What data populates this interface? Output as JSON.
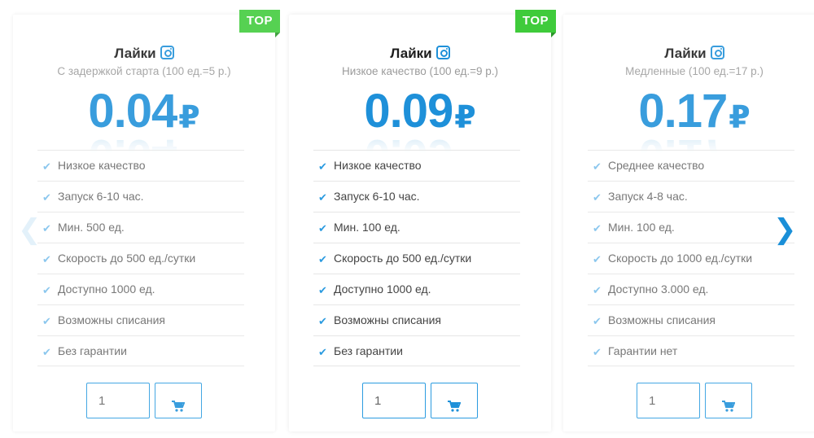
{
  "nav": {
    "prev_glyph": "❮",
    "next_glyph": "❯"
  },
  "cards": [
    {
      "badge": "TOP",
      "title": "Лайки",
      "subtitle": "С задержкой старта (100 ед.=5 р.)",
      "price": "0.04",
      "currency": "₽",
      "features": [
        "Низкое качество",
        "Запуск 6-10 час.",
        "Мин. 500 ед.",
        "Скорость до 500 ед./сутки",
        "Доступно 1000 ед.",
        "Возможны списания",
        "Без гарантии"
      ],
      "quantity": "1"
    },
    {
      "badge": "TOP",
      "title": "Лайки",
      "subtitle": "Низкое качество (100 ед.=9 р.)",
      "price": "0.09",
      "currency": "₽",
      "features": [
        "Низкое качество",
        "Запуск 6-10 час.",
        "Мин. 100 ед.",
        "Скорость до 500 ед./сутки",
        "Доступно 1000 ед.",
        "Возможны списания",
        "Без гарантии"
      ],
      "quantity": "1"
    },
    {
      "badge": "",
      "title": "Лайки",
      "subtitle": "Медленные (100 ед.=17 р.)",
      "price": "0.17",
      "currency": "₽",
      "features": [
        "Среднее качество",
        "Запуск 4-8 час.",
        "Мин. 100 ед.",
        "Скорость до 1000 ед./сутки",
        "Доступно 3.000 ед.",
        "Возможны списания",
        "Гарантии нет"
      ],
      "quantity": "1"
    }
  ],
  "icons": {
    "title": "instagram-icon",
    "feature": "check-icon",
    "button": "cart-icon",
    "prev": "chevron-left-icon",
    "next": "chevron-right-icon"
  },
  "colors": {
    "accent": "#1e90d9",
    "badge": "#3fcb3b",
    "text": "#444444",
    "subtitle": "#9b9b9b"
  }
}
